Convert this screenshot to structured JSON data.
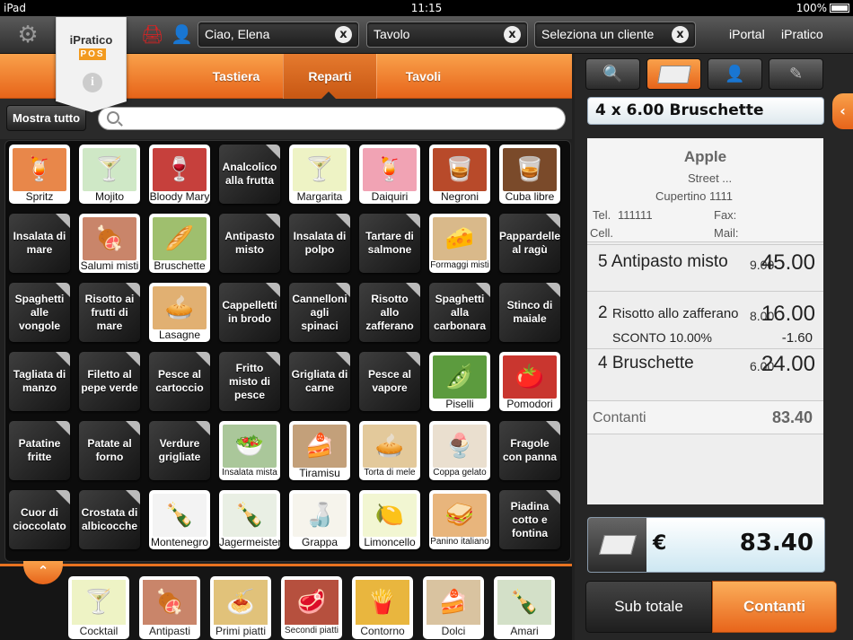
{
  "status_bar": {
    "device": "iPad",
    "time": "11:15",
    "battery": "100%"
  },
  "toolbar": {
    "logo_name": "iPratico",
    "logo_badge": "POS",
    "greeting": "Ciao, Elena",
    "table_field": "Tavolo",
    "customer_field": "Seleziona un cliente",
    "brand_left": "iPortal",
    "brand_right": "iPratico",
    "clear_symbol": "x"
  },
  "tabs": [
    "Tastiera",
    "Reparti",
    "Tavoli"
  ],
  "search": {
    "button": "Mostra tutto",
    "placeholder": ""
  },
  "products": [
    {
      "label": "Spritz",
      "kind": "img",
      "bg": "#e8874a",
      "icon": "🍹"
    },
    {
      "label": "Mojito",
      "kind": "img",
      "bg": "#cfe8c6",
      "icon": "🍸"
    },
    {
      "label": "Bloody Mary",
      "kind": "img",
      "bg": "#c6403c",
      "icon": "🍷"
    },
    {
      "label": "Analcolico alla frutta",
      "kind": "text"
    },
    {
      "label": "Margarita",
      "kind": "img",
      "bg": "#eef3c5",
      "icon": "🍸"
    },
    {
      "label": "Daiquiri",
      "kind": "img",
      "bg": "#f1a3b4",
      "icon": "🍹"
    },
    {
      "label": "Negroni",
      "kind": "img",
      "bg": "#b84a2a",
      "icon": "🥃"
    },
    {
      "label": "Cuba libre",
      "kind": "img",
      "bg": "#7a4a2a",
      "icon": "🥃"
    },
    {
      "label": "Insalata di mare",
      "kind": "text"
    },
    {
      "label": "Salumi misti",
      "kind": "img",
      "bg": "#c9856a",
      "icon": "🍖"
    },
    {
      "label": "Bruschette",
      "kind": "img",
      "bg": "#9fbf6e",
      "icon": "🥖"
    },
    {
      "label": "Antipasto misto",
      "kind": "text"
    },
    {
      "label": "Insalata di polpo",
      "kind": "text"
    },
    {
      "label": "Tartare di salmone",
      "kind": "text"
    },
    {
      "label": "Formaggi misti",
      "kind": "img",
      "bg": "#d9b98a",
      "icon": "🧀",
      "small": true
    },
    {
      "label": "Pappardelle al ragù",
      "kind": "text"
    },
    {
      "label": "Spaghetti alle vongole",
      "kind": "text"
    },
    {
      "label": "Risotto ai frutti di mare",
      "kind": "text"
    },
    {
      "label": "Lasagne",
      "kind": "img",
      "bg": "#e1b072",
      "icon": "🥧"
    },
    {
      "label": "Cappelletti in brodo",
      "kind": "text"
    },
    {
      "label": "Cannelloni agli spinaci",
      "kind": "text"
    },
    {
      "label": "Risotto allo zafferano",
      "kind": "text"
    },
    {
      "label": "Spaghetti alla carbonara",
      "kind": "text"
    },
    {
      "label": "Stinco di maiale",
      "kind": "text"
    },
    {
      "label": "Tagliata di manzo",
      "kind": "text"
    },
    {
      "label": "Filetto al pepe verde",
      "kind": "text"
    },
    {
      "label": "Pesce al cartoccio",
      "kind": "text"
    },
    {
      "label": "Fritto misto di pesce",
      "kind": "text"
    },
    {
      "label": "Grigliata di carne",
      "kind": "text"
    },
    {
      "label": "Pesce al vapore",
      "kind": "text"
    },
    {
      "label": "Piselli",
      "kind": "img",
      "bg": "#5c9b3e",
      "icon": "🫛"
    },
    {
      "label": "Pomodori",
      "kind": "img",
      "bg": "#c9362f",
      "icon": "🍅"
    },
    {
      "label": "Patatine fritte",
      "kind": "text"
    },
    {
      "label": "Patate al forno",
      "kind": "text"
    },
    {
      "label": "Verdure grigliate",
      "kind": "text"
    },
    {
      "label": "Insalata mista",
      "kind": "img",
      "bg": "#aac79a",
      "icon": "🥗",
      "small": true
    },
    {
      "label": "Tiramisu",
      "kind": "img",
      "bg": "#c3a07a",
      "icon": "🍰"
    },
    {
      "label": "Torta di mele",
      "kind": "img",
      "bg": "#e3c99b",
      "icon": "🥧",
      "small": true
    },
    {
      "label": "Coppa gelato",
      "kind": "img",
      "bg": "#eadfcf",
      "icon": "🍨",
      "small": true
    },
    {
      "label": "Fragole con panna",
      "kind": "text"
    },
    {
      "label": "Cuor di cioccolato",
      "kind": "text"
    },
    {
      "label": "Crostata di albicocche",
      "kind": "text"
    },
    {
      "label": "Montenegro",
      "kind": "img",
      "bg": "#f3f3f3",
      "icon": "🍾"
    },
    {
      "label": "Jagermeister",
      "kind": "img",
      "bg": "#e9efe4",
      "icon": "🍾"
    },
    {
      "label": "Grappa",
      "kind": "img",
      "bg": "#f6f4ec",
      "icon": "🍶"
    },
    {
      "label": "Limoncello",
      "kind": "img",
      "bg": "#f2f6d2",
      "icon": "🍋"
    },
    {
      "label": "Panino italiano",
      "kind": "img",
      "bg": "#e8b57c",
      "icon": "🥪",
      "small": true
    },
    {
      "label": "Piadina cotto e fontina",
      "kind": "text"
    }
  ],
  "categories": [
    {
      "label": "Cocktail",
      "bg": "#eef3c5",
      "icon": "🍸"
    },
    {
      "label": "Antipasti",
      "bg": "#c9856a",
      "icon": "🍖"
    },
    {
      "label": "Primi piatti",
      "bg": "#e1c27a",
      "icon": "🍝"
    },
    {
      "label": "Secondi piatti",
      "bg": "#b6503e",
      "icon": "🥩",
      "small": true
    },
    {
      "label": "Contorno",
      "bg": "#e9b63e",
      "icon": "🍟"
    },
    {
      "label": "Dolci",
      "bg": "#d9c3a0",
      "icon": "🍰"
    },
    {
      "label": "Amari",
      "bg": "#d3e0c8",
      "icon": "🍾"
    }
  ],
  "order": {
    "entry": "4 x 6.00 Bruschette",
    "customer": {
      "name": "Apple",
      "street": "Street ...",
      "city": "Cupertino 1111",
      "tel_label": "Tel.",
      "tel": "111111",
      "fax_label": "Fax:",
      "cell_label": "Cell.",
      "mail_label": "Mail:"
    },
    "lines": [
      {
        "qty": "5",
        "name": "Antipasto misto",
        "price": "9.00",
        "total": "45.00"
      },
      {
        "qty": "2",
        "name": "Risotto allo zafferano",
        "price": "8.00",
        "total": "16.00",
        "discount_label": "SCONTO 10.00%",
        "discount": "-1.60"
      },
      {
        "qty": "4",
        "name": "Bruschette",
        "price": "6.00",
        "total": "24.00"
      }
    ],
    "payment_label": "Contanti",
    "payment_total": "83.40",
    "currency": "€",
    "grand_total": "83.40",
    "sub_total_button": "Sub totale",
    "cash_button": "Contanti"
  },
  "colors": {
    "accent": "#e8731f",
    "dark": "#262626"
  }
}
